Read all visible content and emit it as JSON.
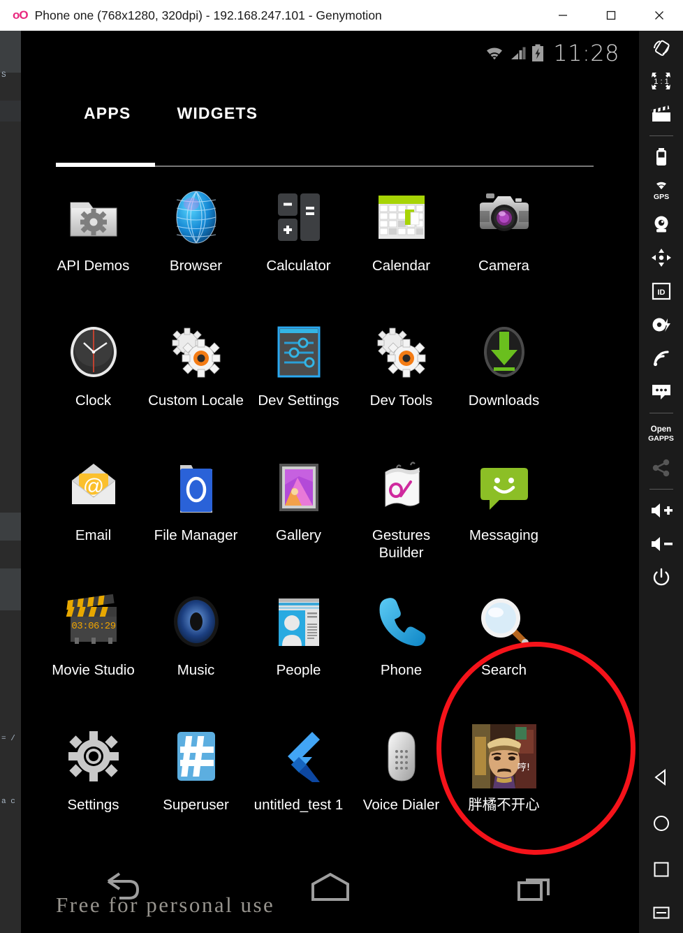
{
  "window": {
    "logo": "oO",
    "title": "Phone one (768x1280, 320dpi) - 192.168.247.101 - Genymotion",
    "controls": [
      {
        "name": "minimize",
        "label": "Minimize"
      },
      {
        "name": "maximize",
        "label": "Maximize"
      },
      {
        "name": "close",
        "label": "Close"
      }
    ]
  },
  "statusbar": {
    "wifi": "wifi-icon",
    "signal": "cellular-signal-icon",
    "battery": "battery-charging-icon",
    "clock": "11:28"
  },
  "tabs": {
    "items": [
      {
        "label": "APPS",
        "selected": true
      },
      {
        "label": "WIDGETS",
        "selected": false
      }
    ]
  },
  "apps": {
    "rows": [
      [
        {
          "label": "API Demos",
          "icon": "api-demos-icon"
        },
        {
          "label": "Browser",
          "icon": "browser-icon"
        },
        {
          "label": "Calculator",
          "icon": "calculator-icon"
        },
        {
          "label": "Calendar",
          "icon": "calendar-icon"
        },
        {
          "label": "Camera",
          "icon": "camera-icon"
        }
      ],
      [
        {
          "label": "Clock",
          "icon": "clock-icon"
        },
        {
          "label": "Custom Locale",
          "icon": "custom-locale-icon"
        },
        {
          "label": "Dev Settings",
          "icon": "dev-settings-icon"
        },
        {
          "label": "Dev Tools",
          "icon": "dev-tools-icon"
        },
        {
          "label": "Downloads",
          "icon": "downloads-icon"
        }
      ],
      [
        {
          "label": "Email",
          "icon": "email-icon"
        },
        {
          "label": "File Manager",
          "icon": "file-manager-icon"
        },
        {
          "label": "Gallery",
          "icon": "gallery-icon"
        },
        {
          "label": "Gestures Builder",
          "icon": "gestures-builder-icon"
        },
        {
          "label": "Messaging",
          "icon": "messaging-icon"
        }
      ],
      [
        {
          "label": "Movie Studio",
          "icon": "movie-studio-icon"
        },
        {
          "label": "Music",
          "icon": "music-icon"
        },
        {
          "label": "People",
          "icon": "people-icon"
        },
        {
          "label": "Phone",
          "icon": "phone-icon"
        },
        {
          "label": "Search",
          "icon": "search-icon"
        }
      ],
      [
        {
          "label": "Settings",
          "icon": "settings-icon"
        },
        {
          "label": "Superuser",
          "icon": "superuser-icon"
        },
        {
          "label": "untitled_test 1",
          "icon": "flutter-icon"
        },
        {
          "label": "Voice Dialer",
          "icon": "voice-dialer-icon"
        },
        {
          "label": "胖橘不开心",
          "icon": "pangju-app-icon"
        }
      ]
    ],
    "movie_studio_timecode": "03:06:29"
  },
  "navbar": {
    "back": "back-icon",
    "home": "home-icon",
    "recents": "recents-icon"
  },
  "watermark": {
    "text": "Free for personal use"
  },
  "annotation": {
    "shape": "ellipse",
    "color": "#f5131a",
    "targets": "胖橘不开心"
  },
  "toolbar": {
    "items": [
      {
        "name": "rotate",
        "label": "Rotate screen"
      },
      {
        "name": "scale-1-1",
        "label": "1 : 1"
      },
      {
        "name": "screen-record",
        "label": "Screen record"
      },
      {
        "name": "battery",
        "label": "Battery"
      },
      {
        "name": "gps",
        "label": "GPS"
      },
      {
        "name": "camera",
        "label": "Camera"
      },
      {
        "name": "dpad",
        "label": "D-pad"
      },
      {
        "name": "identifiers",
        "label": "ID"
      },
      {
        "name": "disk-io",
        "label": "Disk I/O"
      },
      {
        "name": "network",
        "label": "Network"
      },
      {
        "name": "sms",
        "label": "SMS / Phone"
      },
      {
        "name": "open-gapps",
        "label_line1": "Open",
        "label_line2": "GAPPS"
      },
      {
        "name": "share",
        "label": "Share",
        "disabled": true
      },
      {
        "name": "volume-up",
        "label": "Volume up"
      },
      {
        "name": "volume-down",
        "label": "Volume down"
      },
      {
        "name": "power",
        "label": "Power"
      },
      {
        "name": "nav-back",
        "label": "Back"
      },
      {
        "name": "nav-home",
        "label": "Home"
      },
      {
        "name": "nav-recents",
        "label": "Recents"
      },
      {
        "name": "nav-menu",
        "label": "Menu"
      }
    ]
  },
  "colors": {
    "accent_red": "#f5131a",
    "brand_pink": "#e8287e",
    "titlebar_bg": "#ffffff",
    "device_bg": "#000000",
    "toolbar_bg": "#1b1b1b"
  }
}
